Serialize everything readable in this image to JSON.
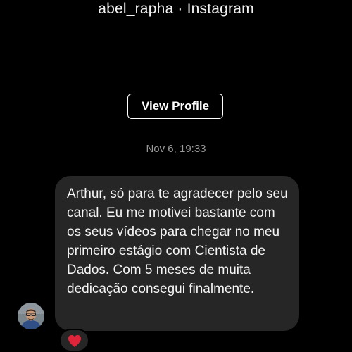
{
  "header": {
    "title": "abel_rapha · Instagram"
  },
  "profile": {
    "view_profile_label": "View Profile"
  },
  "conversation": {
    "timestamp": "Nov 6, 19:33",
    "message": {
      "text": "Arthur, só para te agradecer pelo seu canal. Eu me motivei bastante com os seus vídeos para chegar no meu primeiro estágio com Cientista de Dados. Com 5 meses de muita dedicação consegui finalmente."
    },
    "reaction": {
      "icon": "heart-icon",
      "color": "#e0243a"
    }
  },
  "theme": {
    "background": "#000000",
    "bubble": "#262626",
    "muted_text": "#9a9a9a"
  }
}
